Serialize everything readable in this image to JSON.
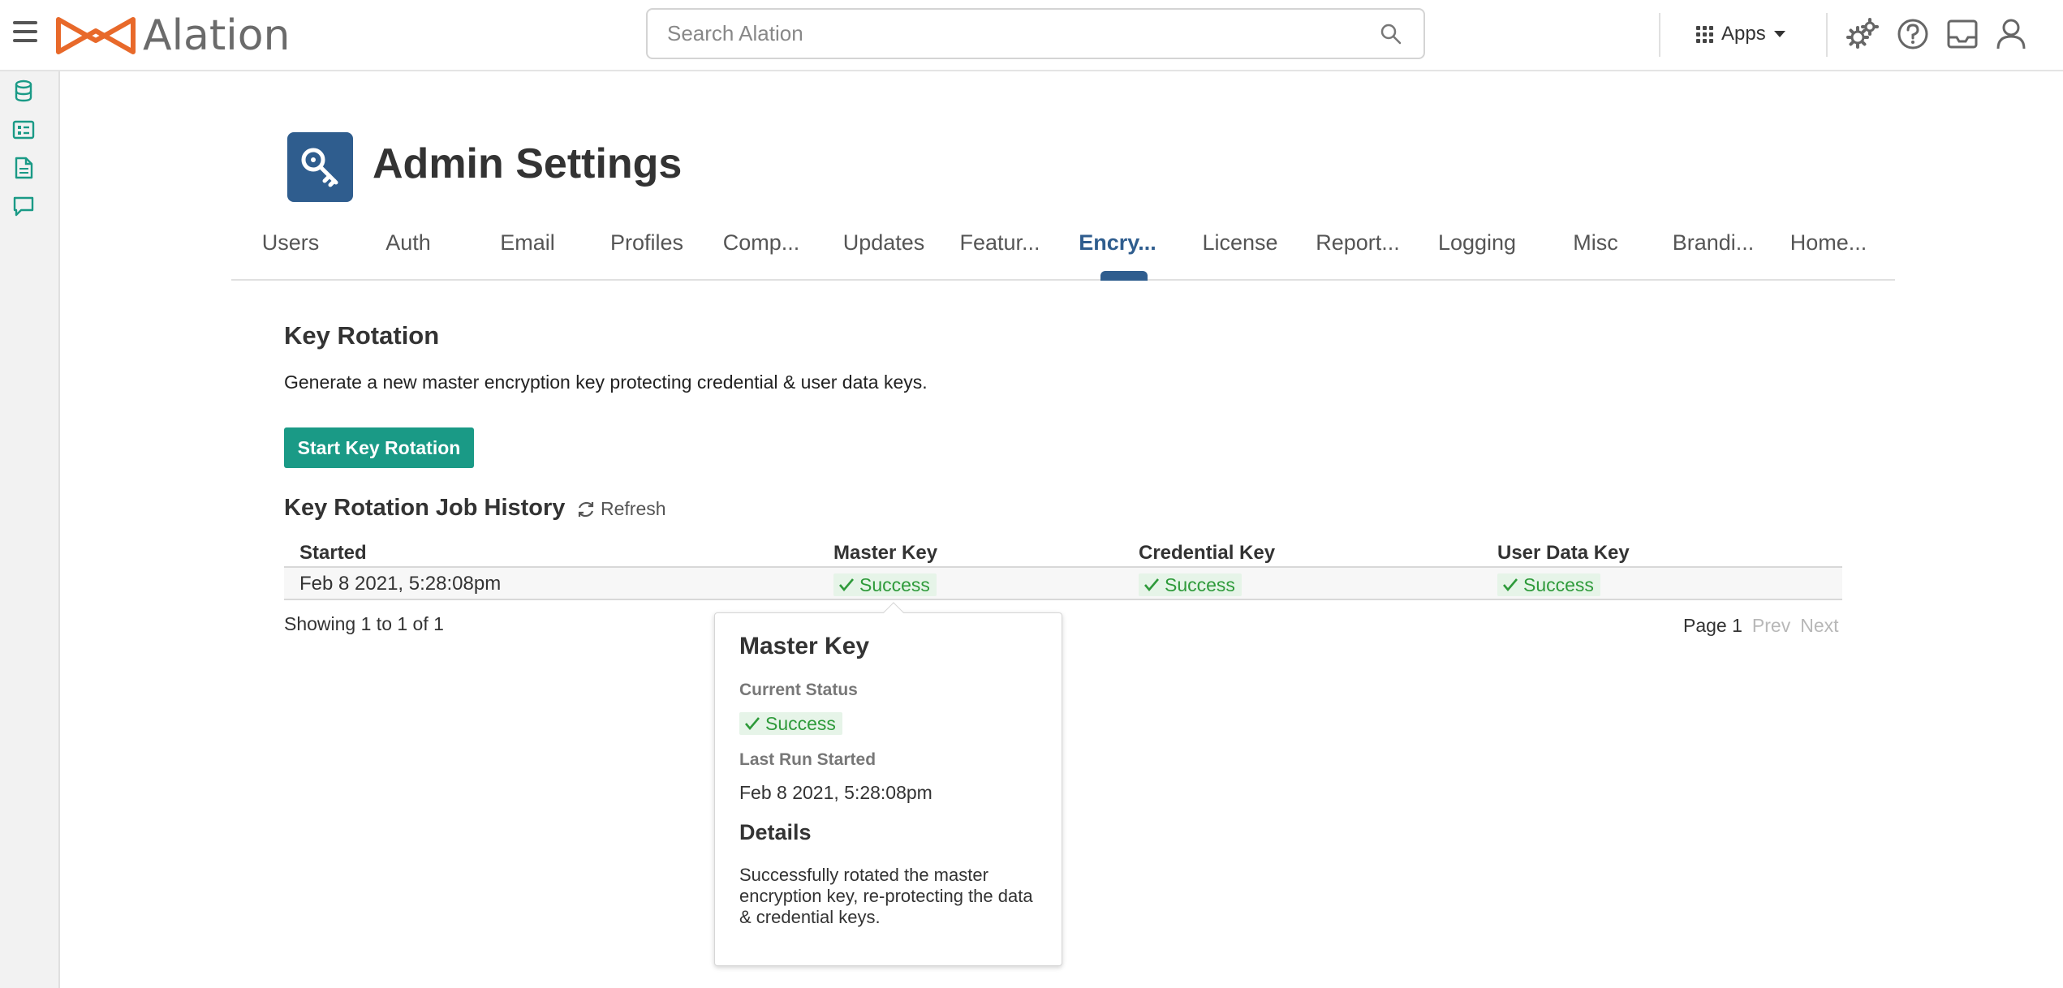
{
  "topbar": {
    "logo_text": "Alation",
    "search_placeholder": "Search Alation",
    "apps_label": "Apps",
    "icons": [
      "menu-icon",
      "search-icon",
      "apps-grid-icon",
      "settings-gears-icon",
      "help-icon",
      "inbox-icon",
      "user-icon"
    ]
  },
  "rail": {
    "icons": [
      "database-icon",
      "catalog-icon",
      "document-icon",
      "conversation-icon"
    ]
  },
  "page": {
    "title": "Admin Settings",
    "icon": "key-icon"
  },
  "tabs": [
    {
      "label": "Users"
    },
    {
      "label": "Auth"
    },
    {
      "label": "Email"
    },
    {
      "label": "Profiles"
    },
    {
      "label": "Comp..."
    },
    {
      "label": "Updates"
    },
    {
      "label": "Featur..."
    },
    {
      "label": "Encry...",
      "active": true
    },
    {
      "label": "License"
    },
    {
      "label": "Report..."
    },
    {
      "label": "Logging"
    },
    {
      "label": "Misc"
    },
    {
      "label": "Brandi..."
    },
    {
      "label": "Home..."
    }
  ],
  "key_rotation": {
    "title": "Key Rotation",
    "description": "Generate a new master encryption key protecting credential & user data keys.",
    "button_label": "Start Key Rotation"
  },
  "history": {
    "title": "Key Rotation Job History",
    "refresh_label": "Refresh",
    "columns": [
      "Started",
      "Master Key",
      "Credential Key",
      "User Data Key"
    ],
    "rows": [
      {
        "started": "Feb 8 2021, 5:28:08pm",
        "master": "Success",
        "credential": "Success",
        "user_data": "Success"
      }
    ],
    "showing": "Showing 1 to 1 of 1",
    "page_label": "Page 1",
    "prev_label": "Prev",
    "next_label": "Next"
  },
  "popover": {
    "title": "Master Key",
    "status_label": "Current Status",
    "status_value": "Success",
    "last_run_label": "Last Run Started",
    "last_run_value": "Feb 8 2021, 5:28:08pm",
    "details_title": "Details",
    "details_text": "Successfully rotated the master encryption key, re-protecting the data & credential keys."
  },
  "colors": {
    "accent": "#2f5d8e",
    "primary_button": "#1a9a86",
    "success_text": "#2e9a3a",
    "success_bg": "#e6f4e8",
    "logo_orange": "#e8692a",
    "rail_icons": "#1a9a86"
  }
}
